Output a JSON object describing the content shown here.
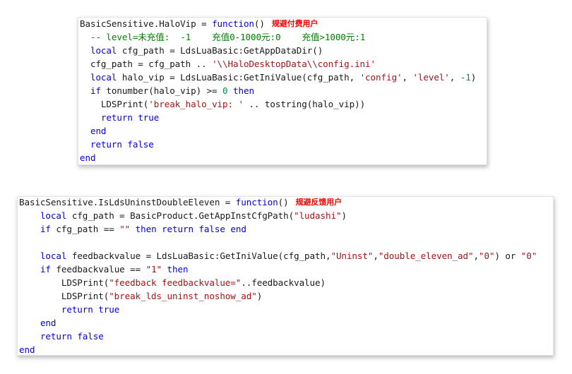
{
  "colors": {
    "keyword": "#0000e6",
    "string": "#a31515",
    "number": "#098658",
    "comment": "#008000",
    "plain": "#1a1a1a",
    "annotation": "#ff0000"
  },
  "snippet1": {
    "annotation": "规避付费用户",
    "lines": [
      [
        [
          "plain",
          "BasicSensitive.HaloVip = "
        ],
        [
          "kw",
          "function"
        ],
        [
          "plain",
          "()"
        ]
      ],
      [
        [
          "cmt",
          "  -- level=未充值:  -1    充值0-1000元:0    充值>1000元:1"
        ]
      ],
      [
        [
          "plain",
          "  "
        ],
        [
          "kw",
          "local"
        ],
        [
          "plain",
          " cfg_path = LdsLuaBasic:GetAppDataDir()"
        ]
      ],
      [
        [
          "plain",
          "  cfg_path = cfg_path .. "
        ],
        [
          "str",
          "'\\\\HaloDesktopData\\\\config.ini'"
        ]
      ],
      [
        [
          "plain",
          "  "
        ],
        [
          "kw",
          "local"
        ],
        [
          "plain",
          " halo_vip = LdsLuaBasic:GetIniValue(cfg_path, "
        ],
        [
          "str",
          "'config'"
        ],
        [
          "plain",
          ", "
        ],
        [
          "str",
          "'level'"
        ],
        [
          "plain",
          ", "
        ],
        [
          "num",
          "-1"
        ],
        [
          "plain",
          ")"
        ]
      ],
      [
        [
          "plain",
          "  "
        ],
        [
          "kw",
          "if"
        ],
        [
          "plain",
          " tonumber(halo_vip) >= "
        ],
        [
          "num",
          "0"
        ],
        [
          "plain",
          " "
        ],
        [
          "kw",
          "then"
        ]
      ],
      [
        [
          "plain",
          "    LDSPrint("
        ],
        [
          "str",
          "'break_halo_vip: '"
        ],
        [
          "plain",
          " .. tostring(halo_vip))"
        ]
      ],
      [
        [
          "plain",
          "    "
        ],
        [
          "kw",
          "return"
        ],
        [
          "plain",
          " "
        ],
        [
          "kw",
          "true"
        ]
      ],
      [
        [
          "plain",
          "  "
        ],
        [
          "kw",
          "end"
        ]
      ],
      [
        [
          "plain",
          "  "
        ],
        [
          "kw",
          "return"
        ],
        [
          "plain",
          " "
        ],
        [
          "kw",
          "false"
        ]
      ],
      [
        [
          "kw",
          "end"
        ]
      ]
    ]
  },
  "snippet2": {
    "annotation": "规避反馈用户",
    "lines": [
      [
        [
          "plain",
          "BasicSensitive.IsLdsUninstDoubleEleven = "
        ],
        [
          "kw",
          "function"
        ],
        [
          "plain",
          "()"
        ]
      ],
      [
        [
          "plain",
          "    "
        ],
        [
          "kw",
          "local"
        ],
        [
          "plain",
          " cfg_path = BasicProduct.GetAppInstCfgPath("
        ],
        [
          "str",
          "\"ludashi\""
        ],
        [
          "plain",
          ")"
        ]
      ],
      [
        [
          "plain",
          "    "
        ],
        [
          "kw",
          "if"
        ],
        [
          "plain",
          " cfg_path == "
        ],
        [
          "str",
          "\"\""
        ],
        [
          "plain",
          " "
        ],
        [
          "kw",
          "then"
        ],
        [
          "plain",
          " "
        ],
        [
          "kw",
          "return"
        ],
        [
          "plain",
          " "
        ],
        [
          "kw",
          "false"
        ],
        [
          "plain",
          " "
        ],
        [
          "kw",
          "end"
        ]
      ],
      [
        [
          "plain",
          ""
        ]
      ],
      [
        [
          "plain",
          "    "
        ],
        [
          "kw",
          "local"
        ],
        [
          "plain",
          " feedbackvalue = LdsLuaBasic:GetIniValue(cfg_path,"
        ],
        [
          "str",
          "\"Uninst\""
        ],
        [
          "plain",
          ","
        ],
        [
          "str",
          "\"double_eleven_ad\""
        ],
        [
          "plain",
          ","
        ],
        [
          "str",
          "\"0\""
        ],
        [
          "plain",
          ") or "
        ],
        [
          "str",
          "\"0\""
        ]
      ],
      [
        [
          "plain",
          "    "
        ],
        [
          "kw",
          "if"
        ],
        [
          "plain",
          " feedbackvalue == "
        ],
        [
          "str",
          "\"1\""
        ],
        [
          "plain",
          " "
        ],
        [
          "kw",
          "then"
        ]
      ],
      [
        [
          "plain",
          "        LDSPrint("
        ],
        [
          "str",
          "\"feedback feedbackvalue=\""
        ],
        [
          "plain",
          "..feedbackvalue)"
        ]
      ],
      [
        [
          "plain",
          "        LDSPrint("
        ],
        [
          "str",
          "\"break_lds_uninst_noshow_ad\""
        ],
        [
          "plain",
          ")"
        ]
      ],
      [
        [
          "plain",
          "        "
        ],
        [
          "kw",
          "return"
        ],
        [
          "plain",
          " "
        ],
        [
          "kw",
          "true"
        ]
      ],
      [
        [
          "plain",
          "    "
        ],
        [
          "kw",
          "end"
        ]
      ],
      [
        [
          "plain",
          "    "
        ],
        [
          "kw",
          "return"
        ],
        [
          "plain",
          " "
        ],
        [
          "kw",
          "false"
        ]
      ],
      [
        [
          "kw",
          "end"
        ]
      ]
    ]
  }
}
